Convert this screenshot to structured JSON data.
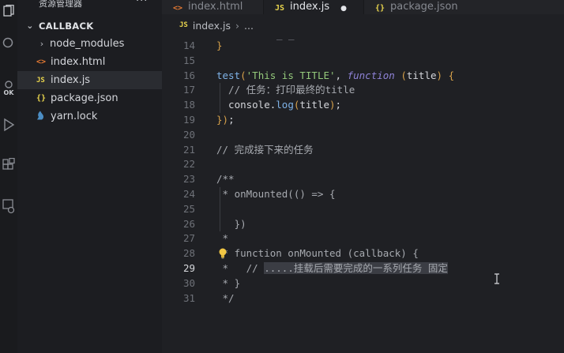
{
  "sidebar": {
    "title": "资源管理器",
    "more": "···",
    "folder": "CALLBACK",
    "items": [
      {
        "label": "node_modules",
        "kind": "folder",
        "icon": "chevron-right-icon"
      },
      {
        "label": "index.html",
        "kind": "html",
        "icon": "<>"
      },
      {
        "label": "index.js",
        "kind": "js",
        "icon": "JS"
      },
      {
        "label": "package.json",
        "kind": "json",
        "icon": "{}"
      },
      {
        "label": "yarn.lock",
        "kind": "yarn",
        "icon": "yarn-icon"
      }
    ],
    "selected": "index.js"
  },
  "activity": {
    "label_run": "OK"
  },
  "tabs": [
    {
      "label": "index.html",
      "icon": "<>",
      "active": false
    },
    {
      "label": "index.js",
      "icon": "JS",
      "active": true,
      "dirty": true
    },
    {
      "label": "package.json",
      "icon": "{}",
      "active": false
    }
  ],
  "breadcrumb": {
    "icon": "JS",
    "file": "index.js",
    "rest": "..."
  },
  "editor": {
    "current_line": 29,
    "top_remnant": "_   _",
    "lines": [
      {
        "n": 14,
        "text": "}"
      },
      {
        "n": 15,
        "text": ""
      },
      {
        "n": 16,
        "text": "test('This is TITLE', function (title) {"
      },
      {
        "n": 17,
        "text": "  // 任务：打印最终的title"
      },
      {
        "n": 18,
        "text": "  console.log(title);"
      },
      {
        "n": 19,
        "text": "});"
      },
      {
        "n": 20,
        "text": ""
      },
      {
        "n": 21,
        "text": "// 完成接下来的任务"
      },
      {
        "n": 22,
        "text": ""
      },
      {
        "n": 23,
        "text": "/**"
      },
      {
        "n": 24,
        "text": " * onMounted(() => {"
      },
      {
        "n": 25,
        "text": ""
      },
      {
        "n": 26,
        "text": "   })"
      },
      {
        "n": 27,
        "text": " *"
      },
      {
        "n": 28,
        "text": " * function onMounted (callback) {"
      },
      {
        "n": 29,
        "text": " *   // .....挂载后需要完成的一系列任务 固定"
      },
      {
        "n": 30,
        "text": " * }"
      },
      {
        "n": 31,
        "text": " */"
      }
    ]
  },
  "colors": {
    "background": "#1f2024",
    "sidebar": "#1c1d21",
    "keyword": "#8e82d6",
    "string": "#94c97b",
    "function": "#7fb3e8",
    "js_icon": "#e8d44d"
  }
}
